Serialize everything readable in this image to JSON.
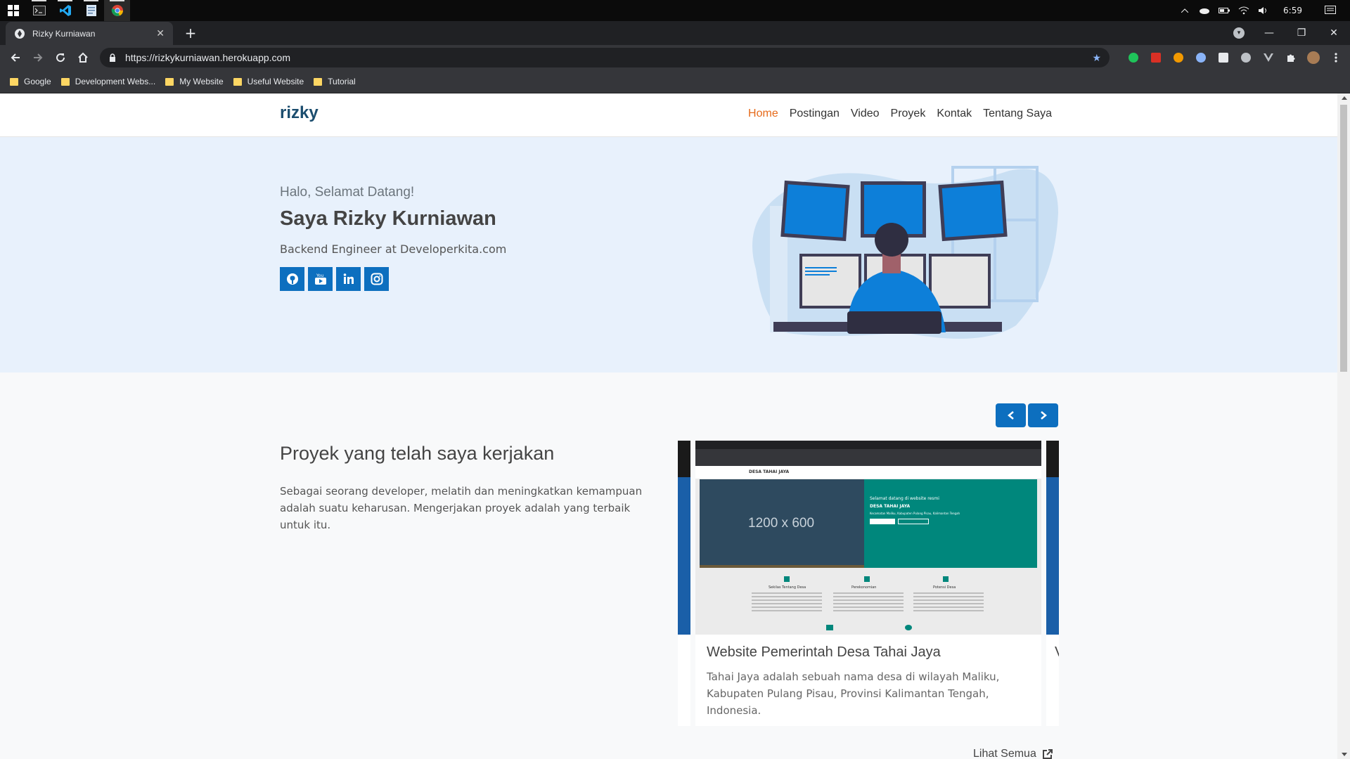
{
  "taskbar": {
    "apps": [
      "windows-start",
      "terminal",
      "vscode",
      "notes",
      "chrome"
    ],
    "time": "6:59"
  },
  "browser": {
    "tab_title": "Rizky Kurniawan",
    "new_tab": "+",
    "url": "https://rizkykurniawan.herokuapp.com",
    "bookmarks": [
      "Google",
      "Development Webs...",
      "My Website",
      "Useful Website",
      "Tutorial"
    ]
  },
  "site": {
    "brand": "rizky",
    "menu": [
      "Home",
      "Postingan",
      "Video",
      "Proyek",
      "Kontak",
      "Tentang Saya"
    ],
    "active_menu": "Home"
  },
  "hero": {
    "greeting": "Halo, Selamat Datang!",
    "name": "Saya Rizky Kurniawan",
    "role": "Backend Engineer at Developerkita.com",
    "socials": [
      "github-icon",
      "youtube-icon",
      "linkedin-icon",
      "instagram-icon"
    ]
  },
  "projects": {
    "title": "Proyek yang telah saya kerjakan",
    "description": "Sebagai seorang developer, melatih dan meningkatkan kemampuan adalah suatu keharusan. Mengerjakan proyek adalah yang terbaik untuk itu.",
    "card": {
      "title": "Website Pemerintah Desa Tahai Jaya",
      "description": "Tahai Jaya adalah sebuah nama desa di wilayah Maliku, Kabupaten Pulang Pisau, Provinsi Kalimantan Tengah, Indonesia.",
      "thumbnail": {
        "site_name": "DESA TAHAI JAYA",
        "slider_text": "1200 x 600",
        "welcome_line1": "Selamat datang di website resmi",
        "welcome_line2": "DESA TAHAI JAYA",
        "welcome_line3": "Kecamatan Maliku, Kabupaten Pulang Pisau, Kalimantan Tengah",
        "features": [
          "Sekilas Tentang Desa",
          "Perekonomian",
          "Potensi Desa"
        ]
      }
    },
    "peek_right_letter": "V",
    "see_all": "Lihat Semua"
  },
  "colors": {
    "primary": "#0d6fbf",
    "nav_active": "#e66a1a",
    "hero_bg": "#e8f1fc",
    "thumb_teal": "#00877c"
  }
}
